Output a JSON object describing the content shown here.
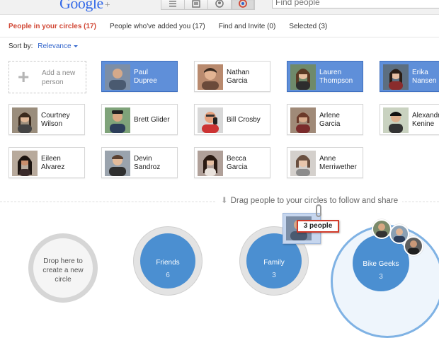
{
  "header": {
    "logo_text": "Google",
    "logo_plus": "+",
    "search_placeholder": "Find people",
    "nav_icons": [
      "stream-icon",
      "photos-icon",
      "profile-icon",
      "circles-icon"
    ]
  },
  "tabs": [
    {
      "label": "People in your circles (17)",
      "active": true
    },
    {
      "label": "People who've added you (17)",
      "active": false
    },
    {
      "label": "Find and Invite (0)",
      "active": false
    },
    {
      "label": "Selected (3)",
      "active": false
    }
  ],
  "sort": {
    "label": "Sort by:",
    "value": "Relevance"
  },
  "add_person": {
    "label": "Add a new person"
  },
  "people": [
    {
      "name": "Paul\nDupree",
      "selected": true
    },
    {
      "name": "Nathan\nGarcia",
      "selected": false
    },
    {
      "name": "Lauren\nThompson",
      "selected": true
    },
    {
      "name": "Erika\nNansen",
      "selected": true
    },
    {
      "name": "Courtney\nWilson",
      "selected": false
    },
    {
      "name": "Brett Glider",
      "selected": false
    },
    {
      "name": "Bill Crosby",
      "selected": false
    },
    {
      "name": "Arlene\nGarcia",
      "selected": false
    },
    {
      "name": "Alexandr\nKenine",
      "selected": false
    },
    {
      "name": "Eileen\nAlvarez",
      "selected": false
    },
    {
      "name": "Devin\nSandroz",
      "selected": false
    },
    {
      "name": "Becca\nGarcia",
      "selected": false
    },
    {
      "name": "Anne\nMerriwether",
      "selected": false
    }
  ],
  "drag_hint": "Drag people to your circles to follow and share",
  "drop_circle_label": "Drop here to create a new circle",
  "drag_badge": "3 people",
  "circles": [
    {
      "name": "Friends",
      "count": "6"
    },
    {
      "name": "Family",
      "count": "3"
    },
    {
      "name": "Bike Geeks",
      "count": "3"
    }
  ],
  "colors": {
    "accent_red": "#d14836",
    "link_blue": "#3366cc",
    "selected_blue": "#5f8fd9",
    "circle_blue": "#4b8fd1"
  }
}
